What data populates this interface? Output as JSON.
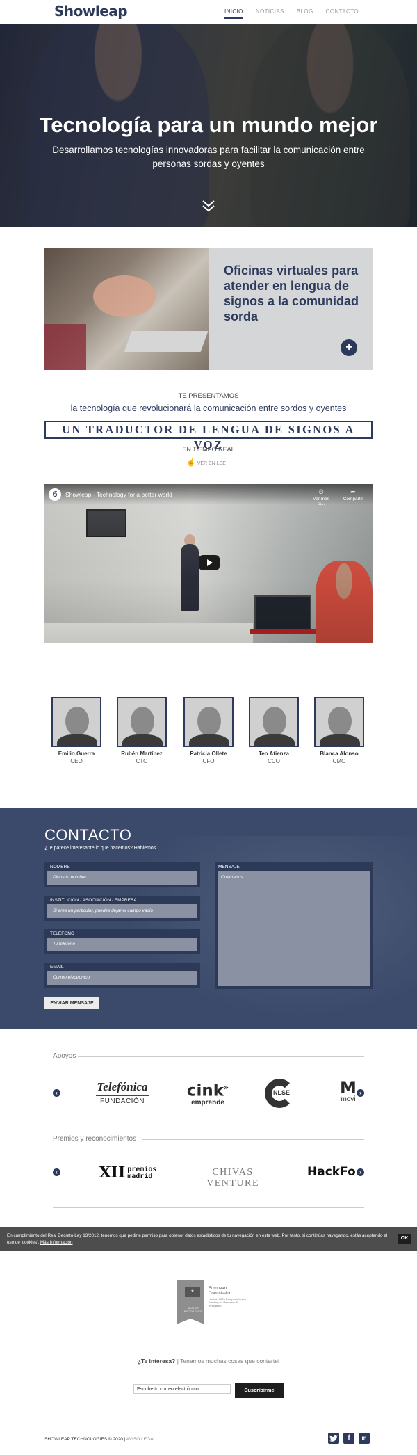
{
  "nav": {
    "logo": "Showleap",
    "links": [
      "INICIO",
      "NOTICIAS",
      "BLOG",
      "CONTACTO"
    ]
  },
  "hero": {
    "title": "Tecnología para un mundo mejor",
    "subtitle": "Desarrollamos tecnologías innovadoras para facilitar la comunicación entre personas sordas y oyentes",
    "arrow_icon": "double-chevron-down"
  },
  "feature": {
    "title": "Oficinas virtuales para atender en lengua de signos a la comunidad sorda",
    "plus": "+"
  },
  "present": {
    "kicker": "TE PRESENTAMOS",
    "line": "la tecnología que revolucionará la comunicación entre sordos y oyentes",
    "box": "UN TRADUCTOR DE LENGUA DE SIGNOS A VOZ",
    "realtime": "EN TIEMPO REAL",
    "lse": "VER EN LSE"
  },
  "video": {
    "channel_logo": "б",
    "title": "Showleap - Technology for a better world",
    "watch_later": "Ver más ta...",
    "share": "Compartir"
  },
  "team": [
    {
      "name": "Emilio Guerra",
      "role": "CEO"
    },
    {
      "name": "Rubén Martínez",
      "role": "CTO"
    },
    {
      "name": "Patricia Ollete",
      "role": "CFO"
    },
    {
      "name": "Teo Atienza",
      "role": "CCO"
    },
    {
      "name": "Blanca Alonso",
      "role": "CMO"
    }
  ],
  "contact": {
    "title": "CONTACTO",
    "subtitle": "¿Te parece interesante lo que hacemos? Hablemos...",
    "fields": [
      {
        "label": "NOMBRE",
        "placeholder": "Dinos tu nombre"
      },
      {
        "label": "INSTITUCIÓN / ASOCIACIÓN / EMPRESA",
        "placeholder": "Si eres un particular, puedes dejar el campo vacío"
      },
      {
        "label": "TELÉFONO",
        "placeholder": "Tu teléfono"
      },
      {
        "label": "EMAIL",
        "placeholder": "Correo electrónico"
      }
    ],
    "message_label": "MENSAJE",
    "message_placeholder": "Cuéntanos...",
    "send": "ENVIAR MENSAJE"
  },
  "supports": {
    "heading": "Apoyos",
    "logos": [
      {
        "line1": "Telefónica",
        "line2": "FUNDACIÓN"
      },
      {
        "line1": "cink",
        "line2": "emprende"
      },
      {
        "line1": "NLSE"
      },
      {
        "line1": "M",
        "line2": "movi"
      }
    ]
  },
  "awards": {
    "heading": "Premios y reconocimientos",
    "logos": [
      {
        "line1": "XII",
        "line2": "premios",
        "line3": "madrid"
      },
      {
        "line1": "CHIVAS VENTURE"
      },
      {
        "line1": "HackFor"
      }
    ]
  },
  "cookie": {
    "text": "En cumplimiento del Real Decreto-Ley 13/2012, tenemos que pedirte permiso para obtener datos estadísticos de tu navegación en esta web. Por tanto, si continúas navegando, estás aceptando el uso de 'cookies'.",
    "more": "Más Información",
    "ok": "OK"
  },
  "eu": {
    "flag": "★",
    "seal_label": "SEAL OF EXCELLENCE",
    "line1": "European",
    "line2": "Commission",
    "small": "Horizon 2020 European Union Funding for Research & Innovation"
  },
  "newsletter": {
    "question": "¿Te interesa?",
    "rest": "Tenemos muchas cosas que contarte!",
    "placeholder": "Escribe tu correo electrónico",
    "button": "Suscribirme"
  },
  "footer": {
    "copy": "SHOWLEAP TECHNOLOGIES © 2020",
    "legal": "AVISO LEGAL",
    "social": [
      "twitter",
      "facebook",
      "linkedin"
    ]
  }
}
